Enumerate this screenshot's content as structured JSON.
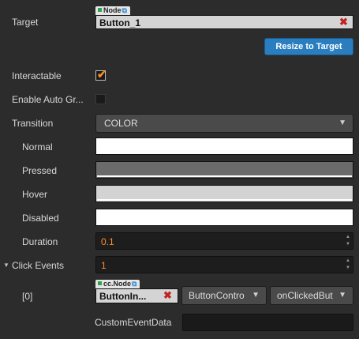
{
  "target": {
    "label": "Target",
    "tag": "Node",
    "value": "Button_1",
    "clear_icon": "✖",
    "resize_button": "Resize to Target"
  },
  "interactable": {
    "label": "Interactable",
    "checked": true
  },
  "auto_gray": {
    "label": "Enable Auto Gr...",
    "checked": false
  },
  "transition": {
    "label": "Transition",
    "value": "COLOR"
  },
  "colors": {
    "normal": {
      "label": "Normal",
      "color": "#ffffff"
    },
    "pressed": {
      "label": "Pressed",
      "color": "#6b6b6b"
    },
    "hover": {
      "label": "Hover",
      "color": "#d3d3d3"
    },
    "disabled": {
      "label": "Disabled",
      "color": "#ffffff"
    }
  },
  "duration": {
    "label": "Duration",
    "value": "0.1"
  },
  "click_events": {
    "label": "Click Events",
    "value": "1"
  },
  "event0": {
    "label": "[0]",
    "tag": "cc.Node",
    "node_value": "ButtonIn...",
    "component": "ButtonContro",
    "handler": "onClickedBut",
    "custom_label": "CustomEventData",
    "custom_value": ""
  },
  "accent_colors": {
    "primary": "#2a7ec0",
    "number": "#ff8d2a",
    "clear": "#c02525"
  }
}
